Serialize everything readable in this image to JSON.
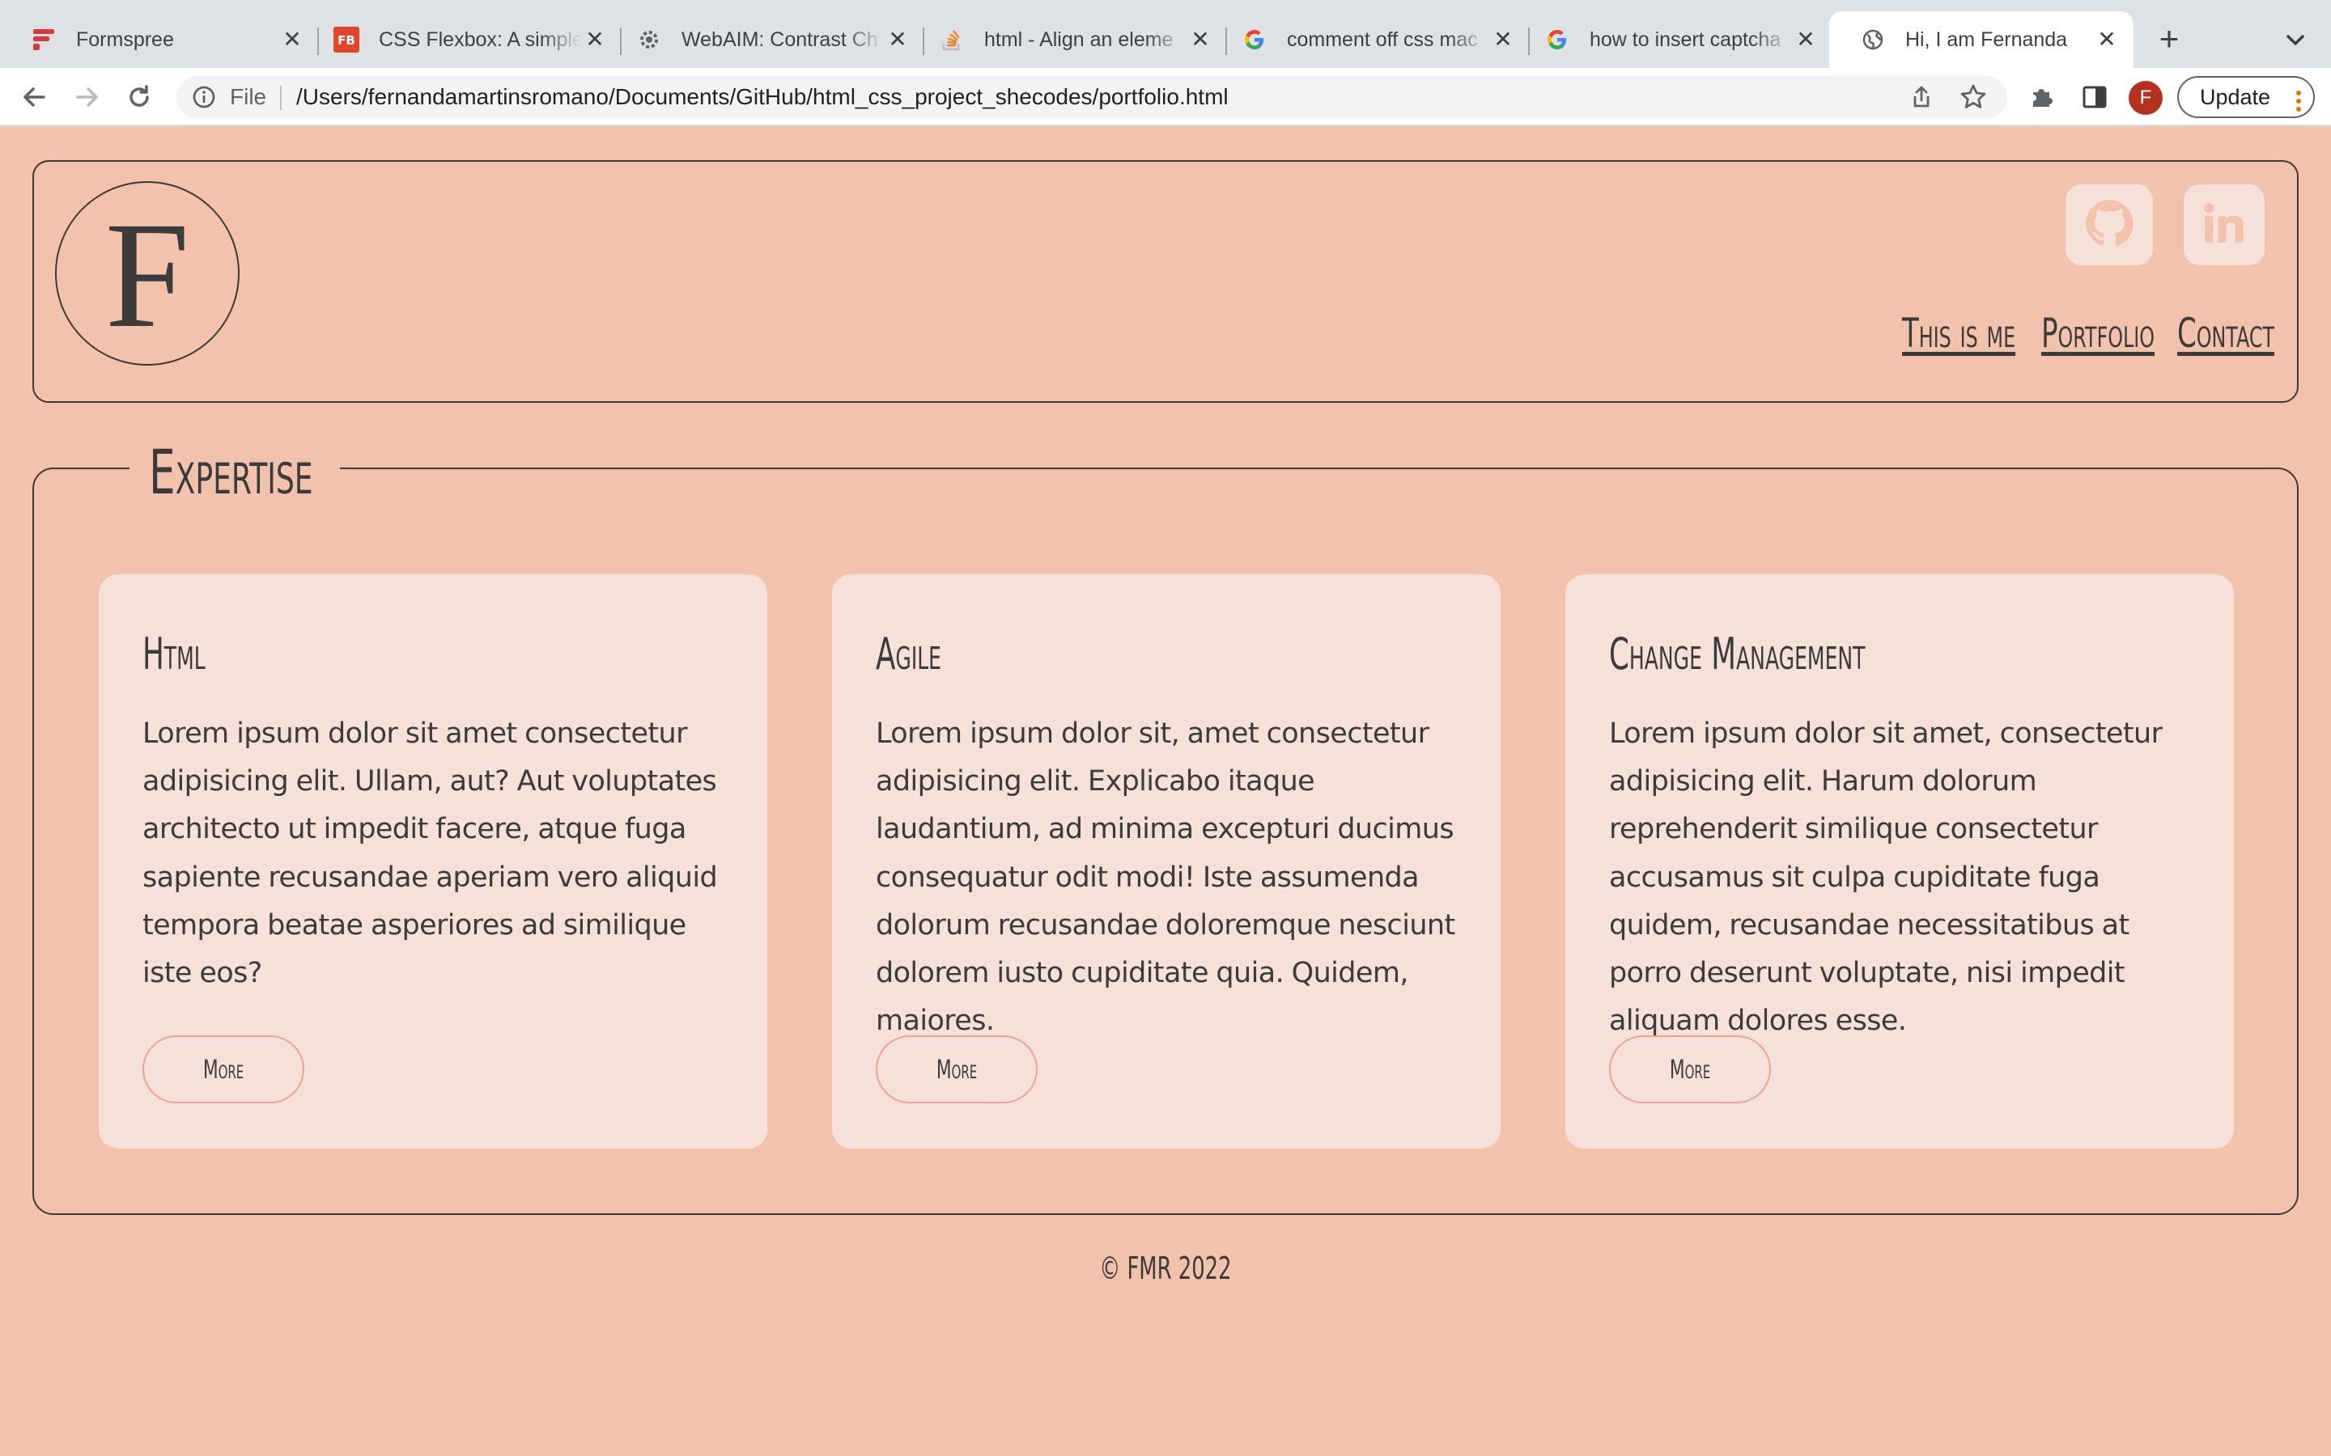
{
  "browser": {
    "tabs": [
      {
        "title": "Formspree",
        "icon": "formspree-icon"
      },
      {
        "title": "CSS Flexbox: A simple",
        "icon": "fb-icon"
      },
      {
        "title": "WebAIM: Contrast Ch",
        "icon": "webaim-icon"
      },
      {
        "title": "html - Align an eleme",
        "icon": "stackoverflow-icon"
      },
      {
        "title": "comment off css mac",
        "icon": "google-icon"
      },
      {
        "title": "how to insert captcha",
        "icon": "google-icon"
      },
      {
        "title": "Hi, I am Fernanda",
        "icon": "globe-icon",
        "active": true
      }
    ],
    "address": {
      "scheme_label": "File",
      "url": "/Users/fernandamartinsromano/Documents/GitHub/html_css_project_shecodes/portfolio.html"
    },
    "profile_initial": "F",
    "update_label": "Update"
  },
  "header": {
    "logo_letter": "F",
    "social": [
      {
        "name": "GitHub",
        "icon": "github-icon"
      },
      {
        "name": "LinkedIn",
        "icon": "linkedin-icon"
      }
    ],
    "nav": [
      "This is me",
      "Portfolio",
      "Contact"
    ]
  },
  "expertise": {
    "title": "Expertise",
    "cards": [
      {
        "title": "Html",
        "text": "Lorem ipsum dolor sit amet consectetur adipisicing elit. Ullam, aut? Aut voluptates architecto ut impedit facere, atque fuga sapiente recusandae aperiam vero aliquid tempora beatae asperiores ad similique iste eos?",
        "button": "More"
      },
      {
        "title": "Agile",
        "text": "Lorem ipsum dolor sit, amet consectetur adipisicing elit. Explicabo itaque laudantium, ad minima excepturi ducimus consequatur odit modi! Iste assumenda dolorum recusandae doloremque nesciunt dolorem iusto cupiditate quia. Quidem, maiores.",
        "button": "More"
      },
      {
        "title": "Change Management",
        "text": "Lorem ipsum dolor sit amet, consectetur adipisicing elit. Harum dolorum reprehenderit similique consectetur accusamus sit culpa cupiditate fuga quidem, recusandae necessitatibus at porro deserunt voluptate, nisi impedit aliquam dolores esse.",
        "button": "More"
      }
    ]
  },
  "footer": {
    "text": "© FMR 2022"
  },
  "colors": {
    "page_background": "#f2c2ad",
    "card_background": "#f6e1da",
    "text": "#3b3b3b",
    "button_border": "#eaa58c"
  }
}
